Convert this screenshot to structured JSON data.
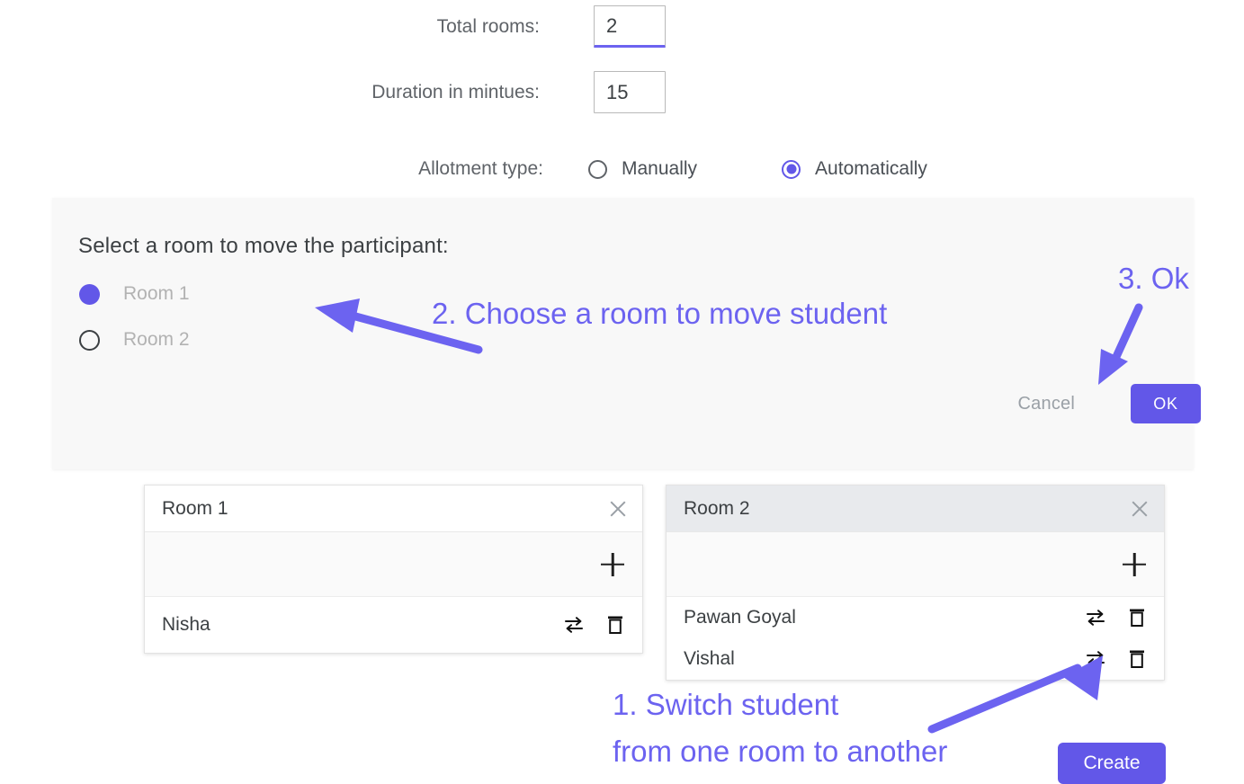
{
  "form": {
    "total_rooms": {
      "label": "Total rooms:",
      "value": "2"
    },
    "duration": {
      "label": "Duration in mintues:",
      "value": "15"
    },
    "allotment": {
      "label": "Allotment type:",
      "options": [
        {
          "label": "Manually",
          "selected": false
        },
        {
          "label": "Automatically",
          "selected": true
        }
      ]
    }
  },
  "move_dialog": {
    "title": "Select a room to move the participant:",
    "options": [
      {
        "label": "Room 1",
        "selected": true
      },
      {
        "label": "Room 2",
        "selected": false
      }
    ],
    "cancel_label": "Cancel",
    "ok_label": "OK"
  },
  "rooms": [
    {
      "title": "Room 1",
      "close_icon": "close-icon",
      "add_icon": "plus-icon",
      "header_shaded": false,
      "participants": [
        {
          "name": "Nisha",
          "swap_icon": "swap-arrows-icon",
          "delete_icon": "trash-icon"
        }
      ]
    },
    {
      "title": "Room 2",
      "close_icon": "close-icon",
      "add_icon": "plus-icon",
      "header_shaded": true,
      "participants": [
        {
          "name": "Pawan Goyal",
          "swap_icon": "swap-arrows-icon",
          "delete_icon": "trash-icon"
        },
        {
          "name": "Vishal",
          "swap_icon": "swap-arrows-icon",
          "delete_icon": "trash-icon"
        }
      ]
    }
  ],
  "annotations": {
    "color": "#6c63f0",
    "step1_line1": "1. Switch student",
    "step1_line2": "from one room to another",
    "step2": "2. Choose a room to move student",
    "step3": "3. Ok"
  },
  "footer": {
    "create_label": "Create"
  }
}
